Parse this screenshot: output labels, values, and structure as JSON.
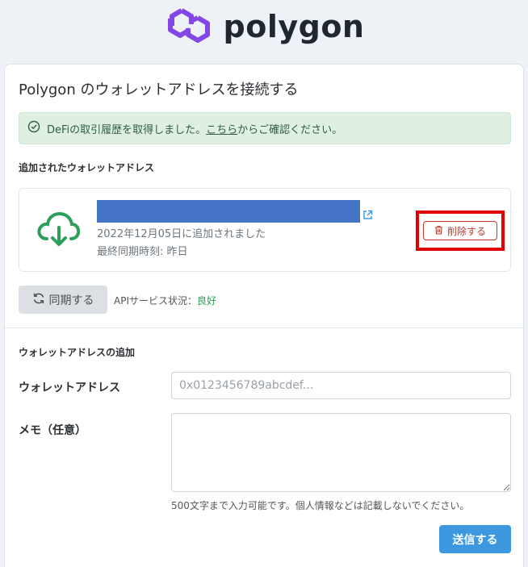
{
  "brand": {
    "name": "polygon",
    "icon": "polygon-logo-icon",
    "color": "#8247e5"
  },
  "page": {
    "title": "Polygon のウォレットアドレスを接続する"
  },
  "alert": {
    "icon": "check-circle-icon",
    "text_before": "DeFiの取引履歴を取得しました。",
    "link_text": "こちら",
    "text_after": "からご確認ください。"
  },
  "wallets_section": {
    "label": "追加されたウォレットアドレス",
    "wallet": {
      "address": "",
      "added_text": "2022年12月05日に追加されました",
      "last_sync_text": "最終同期時刻: 昨日",
      "delete_label": "削除する"
    }
  },
  "sync": {
    "button_label": "同期する",
    "api_status_label": "APIサービス状況：",
    "api_status_value": "良好"
  },
  "add_section": {
    "label": "ウォレットアドレスの追加",
    "wallet_field_label": "ウォレットアドレス",
    "wallet_placeholder": "0x0123456789abcdef...",
    "memo_label": "メモ（任意）",
    "memo_help": "500文字まで入力可能です。個人情報などは記載しないでください。",
    "submit_label": "送信する"
  },
  "colors": {
    "accent": "#3d98e0",
    "success_bg": "#dff0e3",
    "danger": "#c0392b",
    "status_good": "#2e9e5b",
    "redacted": "#4472c4",
    "highlight": "#e00000"
  }
}
